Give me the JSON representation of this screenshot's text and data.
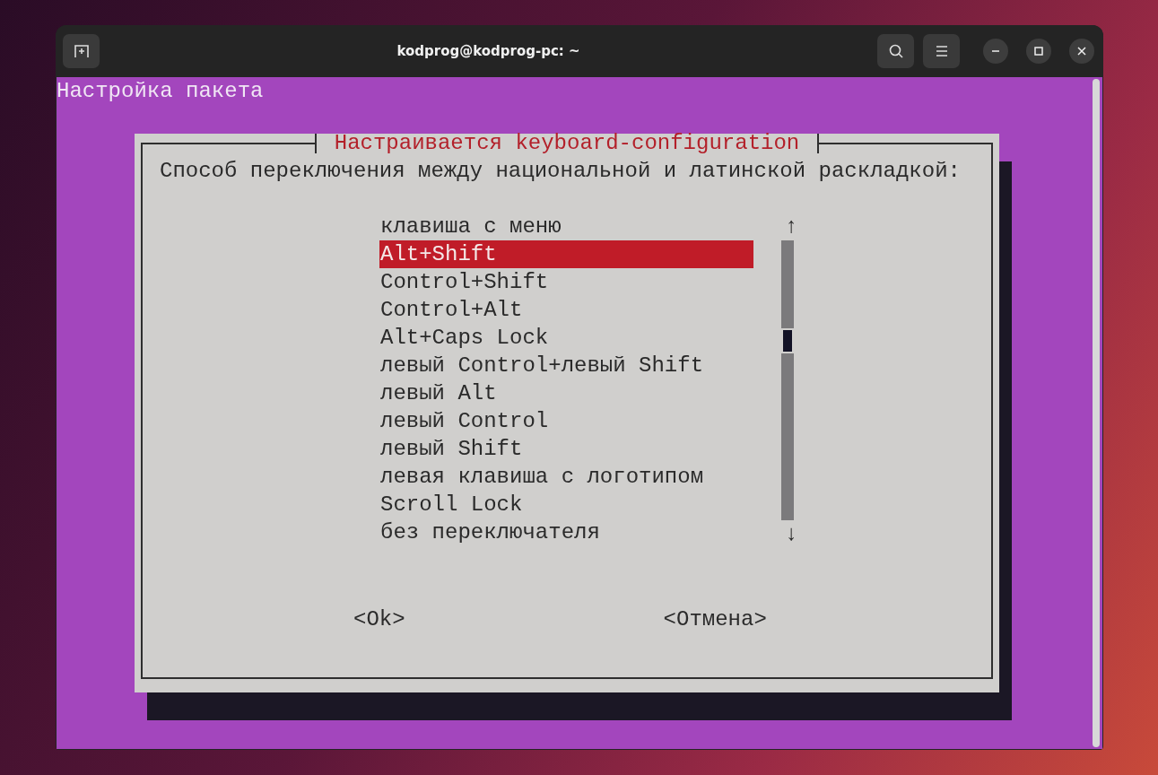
{
  "window": {
    "title": "kodprog@kodprog-pc: ~"
  },
  "terminal": {
    "header": "Настройка пакета"
  },
  "dialog": {
    "title": "Настраивается keyboard-configuration",
    "prompt": "Способ переключения между национальной и латинской раскладкой:",
    "scroll_up": "↑",
    "scroll_down": "↓",
    "items": [
      {
        "label": "клавиша с меню",
        "selected": false
      },
      {
        "label": "Alt+Shift",
        "selected": true
      },
      {
        "label": "Control+Shift",
        "selected": false
      },
      {
        "label": "Control+Alt",
        "selected": false
      },
      {
        "label": "Alt+Caps Lock",
        "selected": false
      },
      {
        "label": "левый Control+левый Shift",
        "selected": false
      },
      {
        "label": "левый Alt",
        "selected": false
      },
      {
        "label": "левый Control",
        "selected": false
      },
      {
        "label": "левый Shift",
        "selected": false
      },
      {
        "label": "левая клавиша с логотипом",
        "selected": false
      },
      {
        "label": "Scroll Lock",
        "selected": false
      },
      {
        "label": "без переключателя",
        "selected": false
      }
    ],
    "buttons": [
      "<Ok>",
      "<Отмена>"
    ]
  }
}
